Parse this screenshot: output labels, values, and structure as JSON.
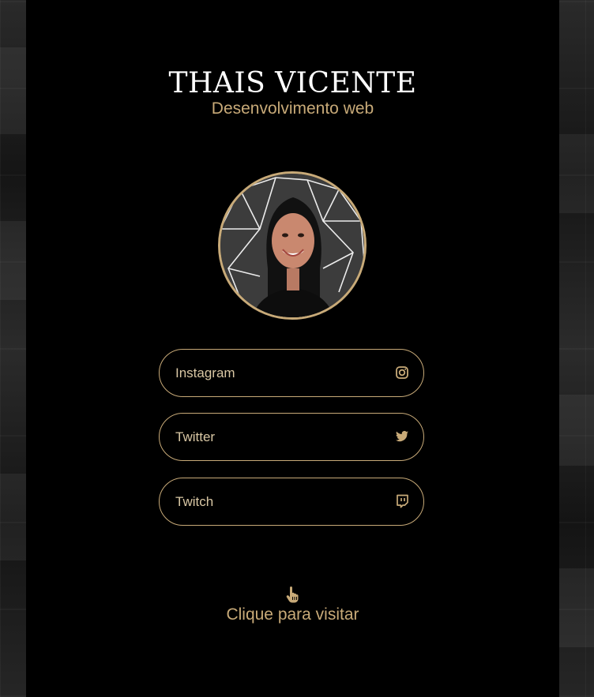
{
  "profile": {
    "name": "THAIS VICENTE",
    "role": "Desenvolvimento web",
    "avatar_icon": "profile-photo"
  },
  "links": [
    {
      "label": "Instagram",
      "icon": "instagram-icon"
    },
    {
      "label": "Twitter",
      "icon": "twitter-icon"
    },
    {
      "label": "Twitch",
      "icon": "twitch-icon"
    }
  ],
  "footer": {
    "hint": "Clique para visitar",
    "hint_icon": "pointer-hand-icon"
  },
  "colors": {
    "accent": "#c8aa78",
    "card_background": "#000000",
    "title": "#ffffff"
  }
}
